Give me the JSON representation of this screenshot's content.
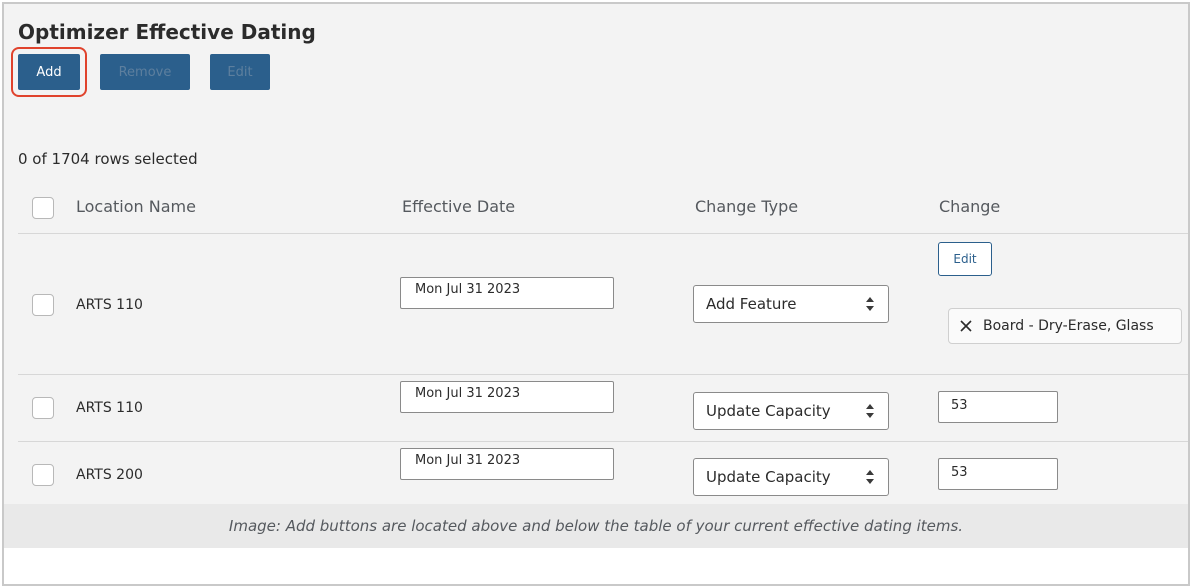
{
  "section": {
    "title": "Optimizer Effective Dating",
    "add_label": "Add",
    "remove_label": "Remove",
    "edit_label": "Edit"
  },
  "table": {
    "rows_selected": "0 of 1704 rows selected",
    "headers": [
      "Location Name",
      "Effective Date",
      "Change Type",
      "Change"
    ],
    "rows": [
      {
        "location": "ARTS 110",
        "date": "Mon Jul 31 2023",
        "change_type": "Add Feature",
        "edit_label": "Edit",
        "feature": "Board - Dry-Erase, Glass"
      },
      {
        "location": "ARTS 110",
        "date": "Mon Jul 31 2023",
        "change_type": "Update Capacity",
        "change": "53"
      },
      {
        "location": "ARTS 200",
        "date": "Mon Jul 31 2023",
        "change_type": "Update Capacity",
        "change": "53"
      }
    ]
  },
  "caption": "Image: Add buttons are located above and below the table of your current effective dating items.",
  "colors": {
    "primary_button": "#2b5f8c",
    "highlight": "#e0432d",
    "panel_background": "#f3f3f3"
  },
  "icons": [
    "sort-arrows-icon",
    "close-icon"
  ]
}
